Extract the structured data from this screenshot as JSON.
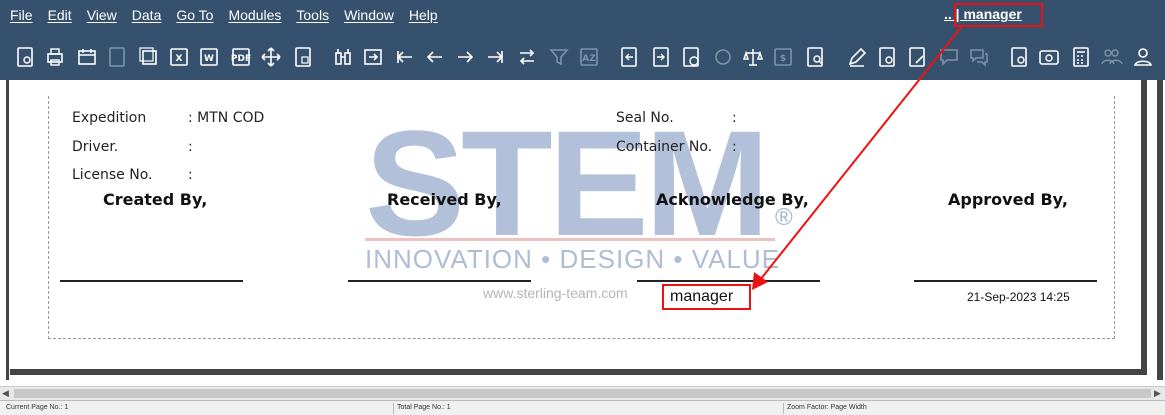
{
  "menubar": {
    "items": [
      "File",
      "Edit",
      "View",
      "Data",
      "Go To",
      "Modules",
      "Tools",
      "Window",
      "Help"
    ],
    "user_label": ".. | manager"
  },
  "colors": {
    "chrome": "#36516d",
    "highlight": "#e11111"
  },
  "toolbar": {
    "icons": [
      "preview-icon",
      "print-icon",
      "page-setup-icon",
      "export-disabled-icon",
      "copy-icon",
      "excel-icon",
      "word-icon",
      "pdf-icon",
      "move-icon",
      "page-icon",
      "find-icon",
      "goto-icon",
      "first-page-icon",
      "prev-page-icon",
      "next-page-icon",
      "last-page-icon",
      "swap-icon",
      "filter-disabled-icon",
      "sort-disabled-icon",
      "document-in-icon",
      "document-out-icon",
      "money-doc-icon",
      "coin-disabled-icon",
      "balance-icon",
      "dollar-doc-disabled-icon",
      "search-doc-icon",
      "edit-icon",
      "settings-doc-icon",
      "edit-doc-icon",
      "comment-disabled-icon",
      "comments-disabled-icon",
      "info-doc-icon",
      "info-card-icon",
      "calculator-icon",
      "users-disabled-icon",
      "user-icon"
    ]
  },
  "report": {
    "left_fields": [
      {
        "label": "Expedition",
        "value": ": MTN COD"
      },
      {
        "label": "Driver.",
        "value": ":"
      },
      {
        "label": "License No.",
        "value": ":"
      }
    ],
    "right_fields": [
      {
        "label": "Seal No.",
        "value": ":"
      },
      {
        "label": "Container No.",
        "value": ":"
      }
    ],
    "signatures": [
      {
        "title": "Created By,",
        "name": ""
      },
      {
        "title": "Received By,",
        "name": ""
      },
      {
        "title": "Acknowledge By,",
        "name": "manager"
      },
      {
        "title": "Approved By,",
        "name": "21-Sep-2023 14:25"
      }
    ]
  },
  "watermark": {
    "brand": "STEM",
    "reg_mark": "®",
    "tagline": "INNOVATION • DESIGN • VALUE",
    "url": "www.sterling-team.com"
  },
  "statusbar": {
    "current_page": "Current Page No.: 1",
    "total_page": "Total Page No.: 1",
    "zoom": "Zoom Factor: Page Width"
  }
}
